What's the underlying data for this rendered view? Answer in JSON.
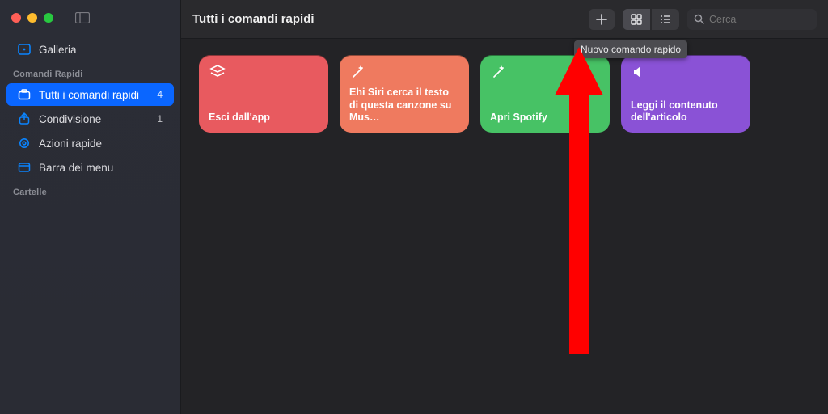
{
  "header": {
    "title": "Tutti i comandi rapidi",
    "search_placeholder": "Cerca",
    "tooltip_new": "Nuovo comando rapido"
  },
  "sidebar": {
    "gallery": "Galleria",
    "section_commands": "Comandi Rapidi",
    "section_folders": "Cartelle",
    "items": [
      {
        "label": "Tutti i comandi rapidi",
        "count": "4"
      },
      {
        "label": "Condivisione",
        "count": "1"
      },
      {
        "label": "Azioni rapide",
        "count": ""
      },
      {
        "label": "Barra dei menu",
        "count": ""
      }
    ]
  },
  "cards": [
    {
      "label": "Esci dall'app",
      "color": "c-red",
      "icon": "layers-icon"
    },
    {
      "label": "Ehi Siri cerca il testo di questa canzone su Mus…",
      "color": "c-orange",
      "icon": "wand-icon"
    },
    {
      "label": "Apri Spotify",
      "color": "c-green",
      "icon": "wand-icon"
    },
    {
      "label": "Leggi il contenuto dell'articolo",
      "color": "c-purple",
      "icon": "speaker-icon"
    }
  ]
}
